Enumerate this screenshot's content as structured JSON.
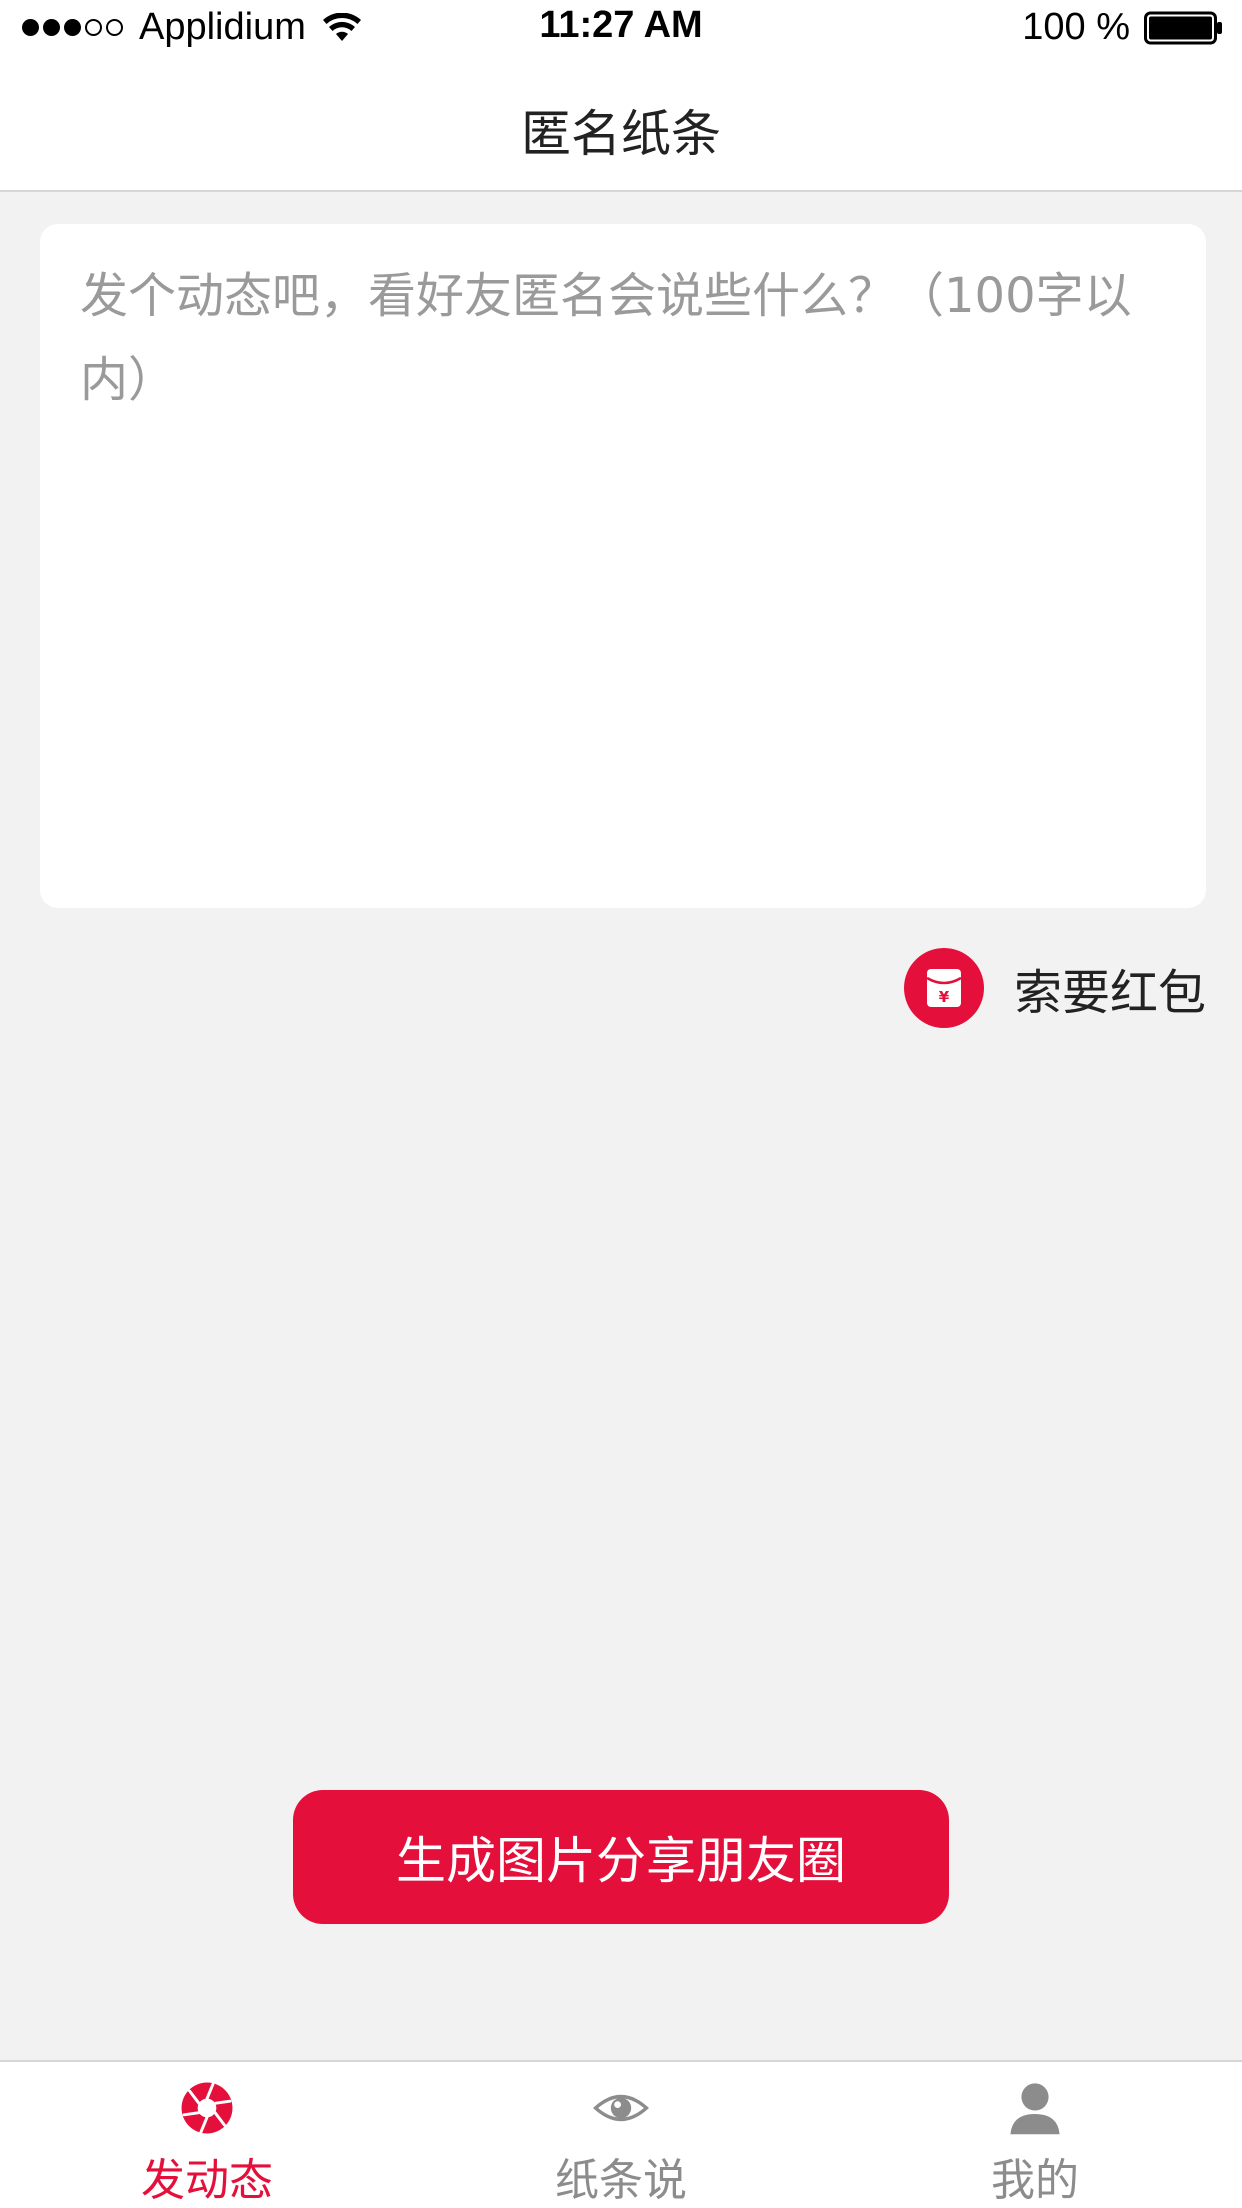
{
  "status_bar": {
    "carrier": "Applidium",
    "time": "11:27 AM",
    "battery": "100 %"
  },
  "nav": {
    "title": "匿名纸条"
  },
  "compose": {
    "placeholder": "发个动态吧，看好友匿名会说些什么？（100字以内）",
    "value": ""
  },
  "red_packet": {
    "label": "索要红包",
    "icon": "red-envelope-icon"
  },
  "share_button": {
    "label": "生成图片分享朋友圈"
  },
  "tabs": [
    {
      "label": "发动态",
      "icon": "camera-aperture-icon",
      "active": true
    },
    {
      "label": "纸条说",
      "icon": "eye-icon",
      "active": false
    },
    {
      "label": "我的",
      "icon": "user-icon",
      "active": false
    }
  ],
  "colors": {
    "accent": "#e40f3a",
    "background": "#f2f2f2",
    "inactive_tab": "#8c8c8c"
  }
}
